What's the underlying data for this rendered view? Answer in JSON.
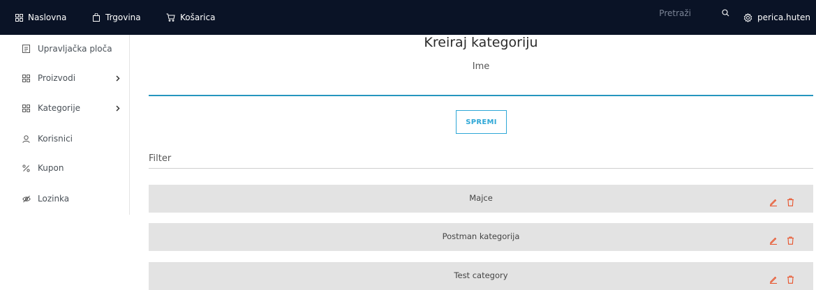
{
  "navbar": {
    "home_label": "Naslovna",
    "shop_label": "Trgovina",
    "cart_label": "Košarica",
    "search_placeholder": "Pretraži",
    "user_label": "perica.huten",
    "bg_color": "#0a1326"
  },
  "sidebar": {
    "items": [
      {
        "label": "Upravljačka ploča",
        "icon": "dashboard-icon",
        "has_submenu": false
      },
      {
        "label": "Proizvodi",
        "icon": "grid-icon",
        "has_submenu": true
      },
      {
        "label": "Kategorije",
        "icon": "grid-icon",
        "has_submenu": true
      },
      {
        "label": "Korisnici",
        "icon": "user-icon",
        "has_submenu": false
      },
      {
        "label": "Kupon",
        "icon": "percent-icon",
        "has_submenu": false
      },
      {
        "label": "Lozinka",
        "icon": "eye-off-icon",
        "has_submenu": false
      }
    ]
  },
  "main": {
    "title": "Kreiraj kategoriju",
    "name_label": "Ime",
    "name_value": "",
    "save_label": "SPREMI",
    "filter_placeholder": "Filter",
    "filter_value": "",
    "accent_color": "#2596be",
    "categories": [
      {
        "name": "Majce"
      },
      {
        "name": "Postman kategorija"
      },
      {
        "name": "Test category"
      }
    ],
    "edit_icon": "pencil-icon",
    "delete_icon": "trash-icon",
    "action_color": "#e8532b"
  }
}
